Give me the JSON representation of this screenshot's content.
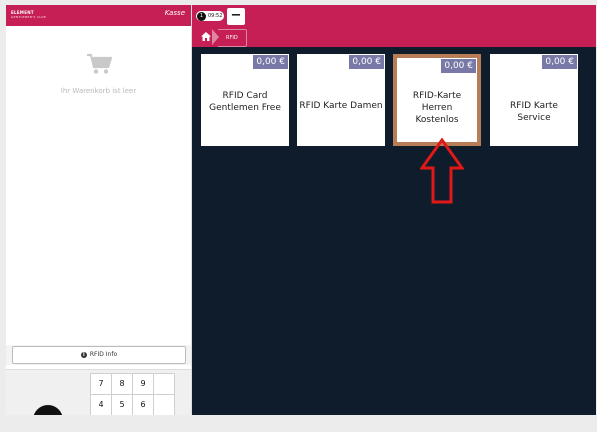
{
  "left_panel": {
    "logo": "ELEMENT",
    "logo_sub": "GENTLEMEN'S CLUB",
    "mode": "Kasse",
    "cart_empty": "Ihr Warenkorb ist leer",
    "rfid_info_button": "RFID Info",
    "numpad": [
      "7",
      "8",
      "9",
      "4",
      "5",
      "6"
    ]
  },
  "header": {
    "badge": "1",
    "time": "09:52",
    "minus": "−",
    "breadcrumb": "RFID"
  },
  "tiles": [
    {
      "price": "0,00 €",
      "label": "RFID Card Gentlemen Free"
    },
    {
      "price": "0,00 €",
      "label": "RFID Karte Damen"
    },
    {
      "price": "0,00 €",
      "label": "RFID-Karte Herren Kostenlos"
    },
    {
      "price": "0,00 €",
      "label": "RFID Karte Service"
    }
  ],
  "colors": {
    "brand": "#c51f56",
    "panel_dark": "#0e1c2b",
    "highlight": "#b87d56",
    "annotation_arrow": "#e01818"
  }
}
